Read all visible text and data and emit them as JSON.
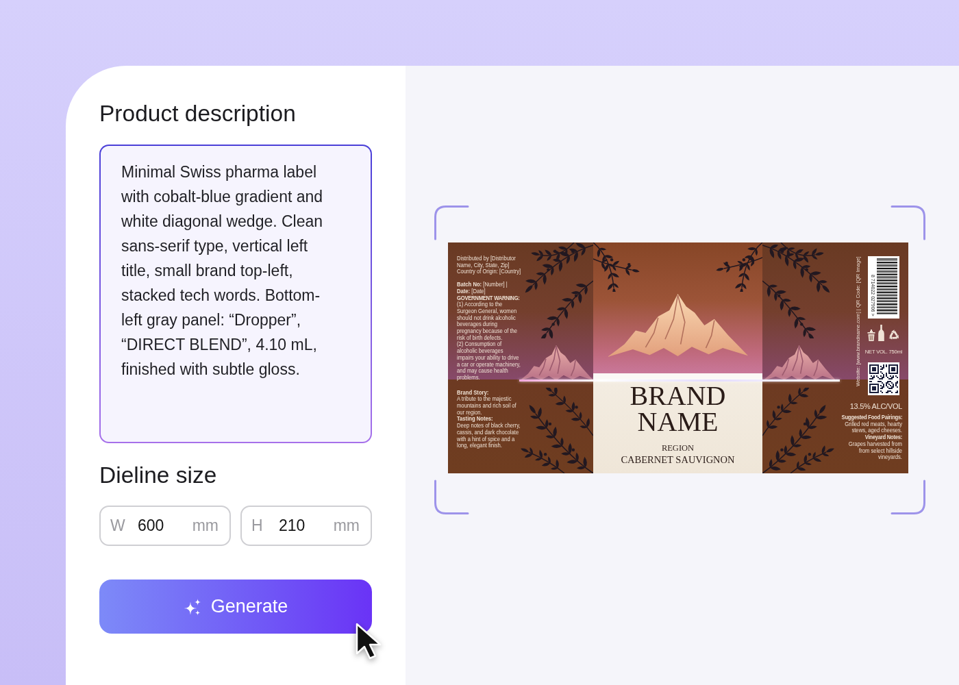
{
  "description_panel": {
    "heading": "Product description",
    "text": "Minimal Swiss pharma label with cobalt-blue gradient and white diagonal wedge. Clean sans-serif type, vertical left title, small brand top-left, stacked tech words. Bottom-left gray panel: “Dropper”, “DIRECT BLEND”, 4.10 mL, finished with subtle gloss."
  },
  "dieline": {
    "heading": "Dieline size",
    "fields": [
      {
        "prefix": "W",
        "value": "600",
        "unit": "mm"
      },
      {
        "prefix": "H",
        "value": "210",
        "unit": "mm"
      }
    ]
  },
  "generate_button": {
    "label": "Generate"
  },
  "preview": {
    "label": {
      "left_panel": {
        "distributor": [
          "Distributed by [Distributor Name, City, State, Zip]",
          "Country of Origin: [Country]"
        ],
        "batch": "**Batch No:** [Number] | **Date:** [Date]",
        "warning": {
          "heading": "GOVERNMENT WARNING:",
          "items": [
            "(1) According to the Surgeon General, women should not drink alcoholic beverages during pregnancy because of the risk of birth defects.",
            "(2) Consumption of alcoholic beverages impairs your ability to drive a car or operate machinery, and may cause health problems."
          ]
        },
        "notes": [
          {
            "heading": "Brand Story:",
            "text": "A tribute to the majestic mountains and rich soil of our region."
          },
          {
            "heading": "Tasting Notes:",
            "text": "Deep notes of black cherry, cassis, and dark chocolate with a hint of spice and a long, elegant finish."
          }
        ]
      },
      "center_panel": {
        "brand": "BRAND NAME",
        "region": "REGION",
        "variety": "CABERNET SAUVIGNON"
      },
      "right_panel": {
        "side_text": "Website: [www.brandname.com]  |  QR Code: [QR Image]",
        "barcode_digits": "8 714022 027906 >",
        "net_volume": "NET VOL. 750ml",
        "alcohol": "13.5% ALC/VOL",
        "notes": [
          {
            "heading": "Suggested Food Pairings:",
            "text": "Grilled red meats, hearty stews, aged cheeses."
          },
          {
            "heading": "Vineyard Notes:",
            "text": "Grapes harvested from from select hillside vineyards."
          }
        ]
      }
    }
  }
}
